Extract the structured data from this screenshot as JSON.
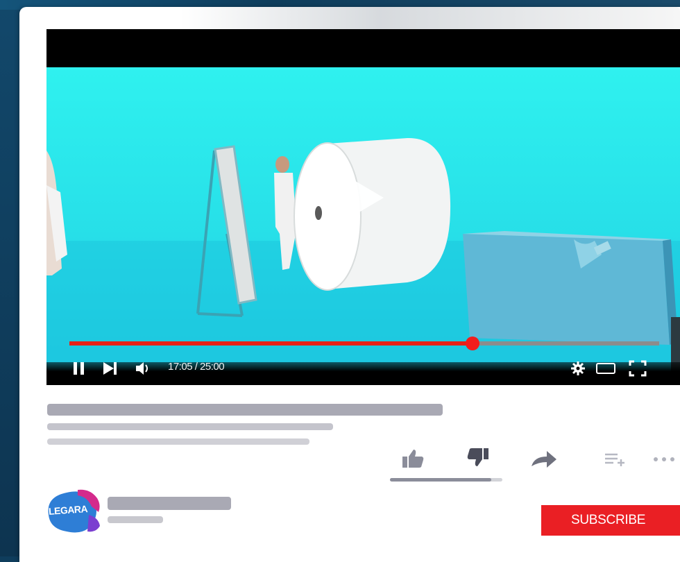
{
  "player": {
    "time_display": "17:05 / 25:00",
    "progress_fraction": 0.683,
    "colors": {
      "progress": "#e62117",
      "knob": "#f21d1d",
      "scene_bg": "#2ff1ef"
    },
    "icons": [
      "pause-icon",
      "next-icon",
      "volume-icon",
      "settings-icon",
      "theater-icon",
      "fullscreen-icon",
      "play-icon"
    ]
  },
  "actions": {
    "icons": [
      "like-icon",
      "dislike-icon",
      "share-icon",
      "add-to-playlist-icon",
      "more-icon"
    ],
    "like_ratio_fraction": 0.9
  },
  "channel": {
    "avatar_text": "LEGARA",
    "subscribe_label": "SUBSCRIBE",
    "colors": {
      "subscribe": "#ea1f24",
      "avatar_blue": "#2e7ed6",
      "avatar_magenta": "#d42a8c"
    }
  }
}
